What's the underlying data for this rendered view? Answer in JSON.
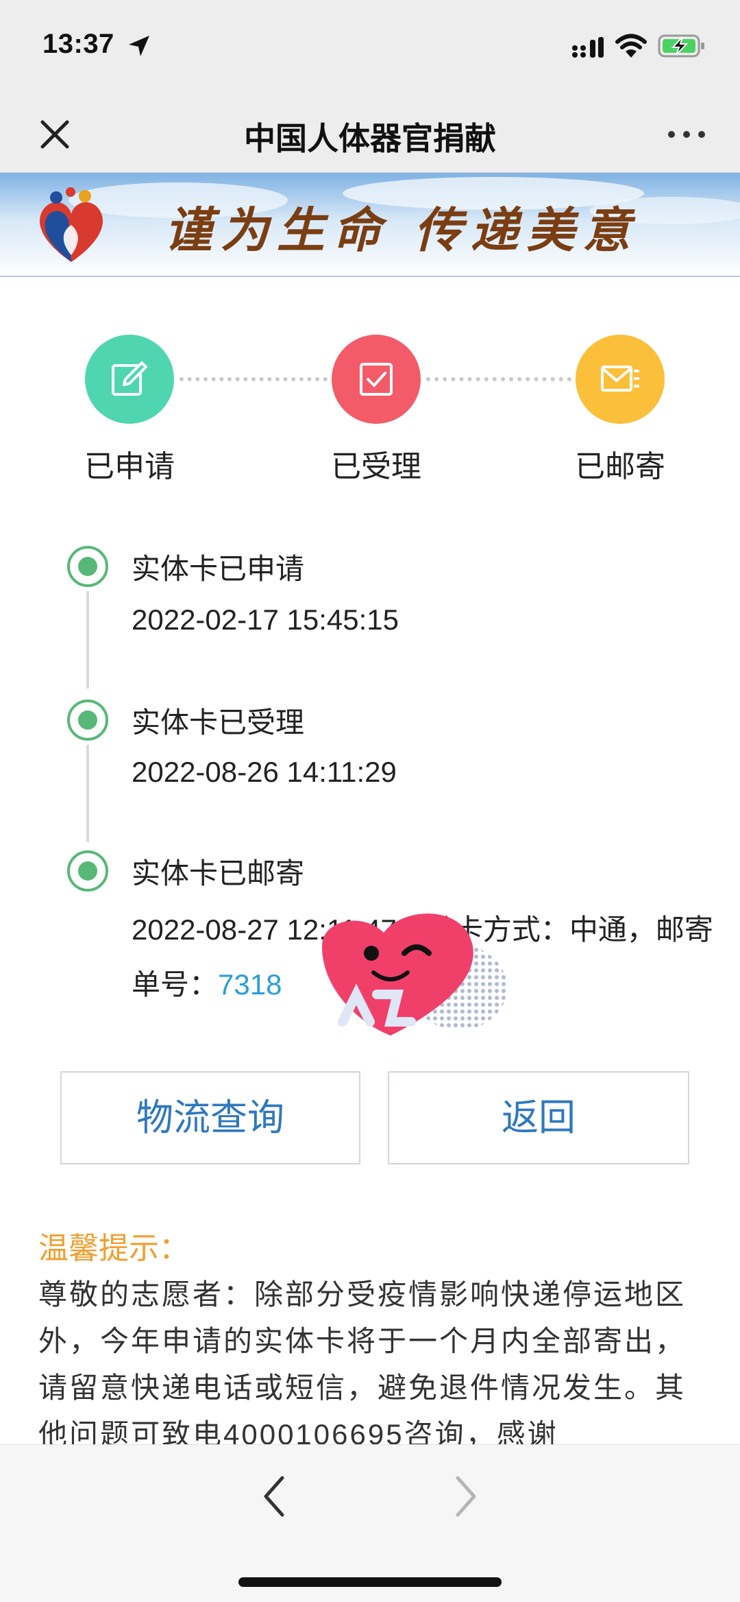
{
  "status_bar": {
    "time": "13:37",
    "location_icon": "location-arrow-icon",
    "signal_icon": "cellular-signal-icon",
    "wifi_icon": "wifi-icon",
    "battery_icon": "battery-charging-icon"
  },
  "nav": {
    "title": "中国人体器官捐献",
    "close_icon": "close-icon",
    "more_icon": "more-dots-icon"
  },
  "banner": {
    "slogan": "谨为生命 传递美意",
    "logo_icon": "organ-donation-heart-logo"
  },
  "steps": [
    {
      "label": "已申请",
      "icon": "edit-icon",
      "color": "#4fd6b0"
    },
    {
      "label": "已受理",
      "icon": "checkbox-icon",
      "color": "#f45b68"
    },
    {
      "label": "已邮寄",
      "icon": "mail-icon",
      "color": "#fbbf3a"
    }
  ],
  "timeline": [
    {
      "title": "实体卡已申请",
      "time": "2022-02-17 15:45:15"
    },
    {
      "title": "实体卡已受理",
      "time": "2022-08-26 14:11:29"
    },
    {
      "title": "实体卡已邮寄",
      "time": "2022-08-27 12:11:47",
      "detail_prefix": "，发卡方式：中通，邮寄单号：",
      "tracking_number": "7318"
    }
  ],
  "buttons": {
    "logistics": "物流查询",
    "back": "返回"
  },
  "tips": {
    "title": "温馨提示：",
    "body": "尊敬的志愿者：除部分受疫情影响快递停运地区外，今年申请的实体卡将于一个月内全部寄出，请留意快递电话或短信，避免退件情况发生。其他问题可致电4000106695咨询，感谢"
  },
  "bottom_bar": {
    "back_icon": "chevron-left-icon",
    "forward_icon": "chevron-right-icon"
  },
  "colors": {
    "accent_blue": "#2f78bf",
    "timeline_green": "#57b87a",
    "tips_orange": "#f0a030",
    "link_blue": "#2a9fd8"
  }
}
